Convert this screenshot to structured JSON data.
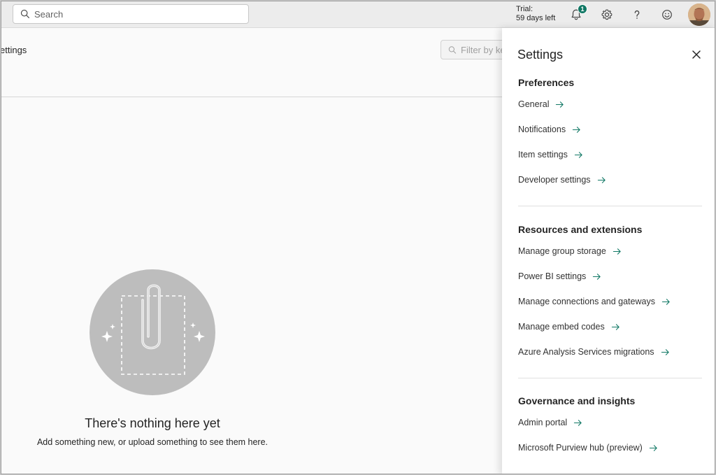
{
  "topbar": {
    "search_placeholder": "Search",
    "trial_line1": "Trial:",
    "trial_line2": "59 days left",
    "notification_count": "1"
  },
  "main": {
    "breadcrumb": "ettings",
    "filter_placeholder": "Filter by ke",
    "empty_title": "There's nothing here yet",
    "empty_subtitle": "Add something new, or upload something to see them here."
  },
  "settings": {
    "title": "Settings",
    "preferences": {
      "heading": "Preferences",
      "items": [
        "General",
        "Notifications",
        "Item settings",
        "Developer settings"
      ]
    },
    "resources": {
      "heading": "Resources and extensions",
      "items": [
        "Manage group storage",
        "Power BI settings",
        "Manage connections and gateways",
        "Manage embed codes",
        "Azure Analysis Services migrations"
      ]
    },
    "governance": {
      "heading": "Governance and insights",
      "items": [
        "Admin portal",
        "Microsoft Purview hub (preview)"
      ]
    }
  },
  "colors": {
    "accent": "#117865",
    "link_arrow": "#117865"
  }
}
